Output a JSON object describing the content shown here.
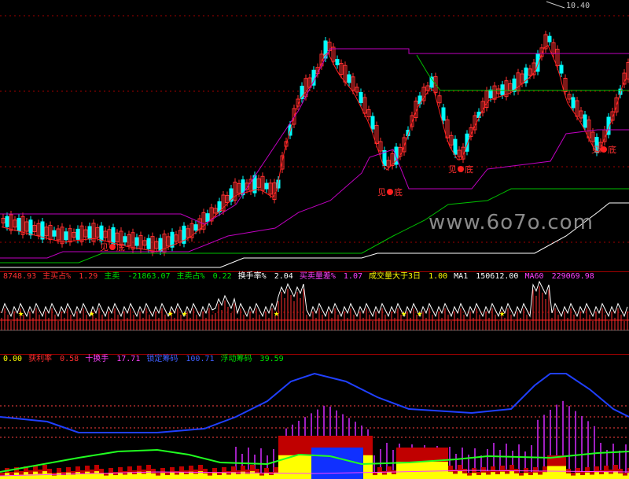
{
  "main": {
    "peak_value": "10.40",
    "bottom_marks": [
      {
        "left": "见",
        "right": "底"
      },
      {
        "left": "见",
        "right": "底"
      },
      {
        "left": "见",
        "right": "底"
      },
      {
        "left": "见",
        "right": "底"
      }
    ],
    "watermark": "www.6o7o.com"
  },
  "indicator1": {
    "items": [
      {
        "label": "",
        "value": "8748.93",
        "color": "#ff3030"
      },
      {
        "label": "主买占%",
        "value": "1.29",
        "color": "#ff3030"
      },
      {
        "label": "主卖",
        "value": "-21863.07",
        "color": "#00e000"
      },
      {
        "label": "主卖占%",
        "value": "0.22",
        "color": "#00e000"
      },
      {
        "label": "换手率%",
        "value": "2.04",
        "color": "#ffffff"
      },
      {
        "label": "买卖量差%",
        "value": "1.07",
        "color": "#ff40ff"
      },
      {
        "label": "成交量大于3日",
        "value": "1.00",
        "color": "#ffff00"
      },
      {
        "label": "MA1",
        "value": "150612.00",
        "color": "#ffffff"
      },
      {
        "label": "MA60",
        "value": "229069.98",
        "color": "#ff40ff"
      }
    ]
  },
  "indicator2": {
    "items": [
      {
        "label": "",
        "value": "0.00",
        "color": "#ffff00"
      },
      {
        "label": "获利率",
        "value": "0.58",
        "color": "#ff3030"
      },
      {
        "label": "十换手",
        "value": "17.71",
        "color": "#ff40ff"
      },
      {
        "label": "锁定筹码",
        "value": "100.71",
        "color": "#4060ff"
      },
      {
        "label": "浮动筹码",
        "value": "39.59",
        "color": "#00e000"
      }
    ]
  },
  "colors": {
    "up": "#ff3030",
    "down": "#00ffff",
    "magenta": "#c000c0",
    "green": "#00c000",
    "white": "#ffffff",
    "blue": "#2040ff",
    "yellow": "#ffff00"
  }
}
